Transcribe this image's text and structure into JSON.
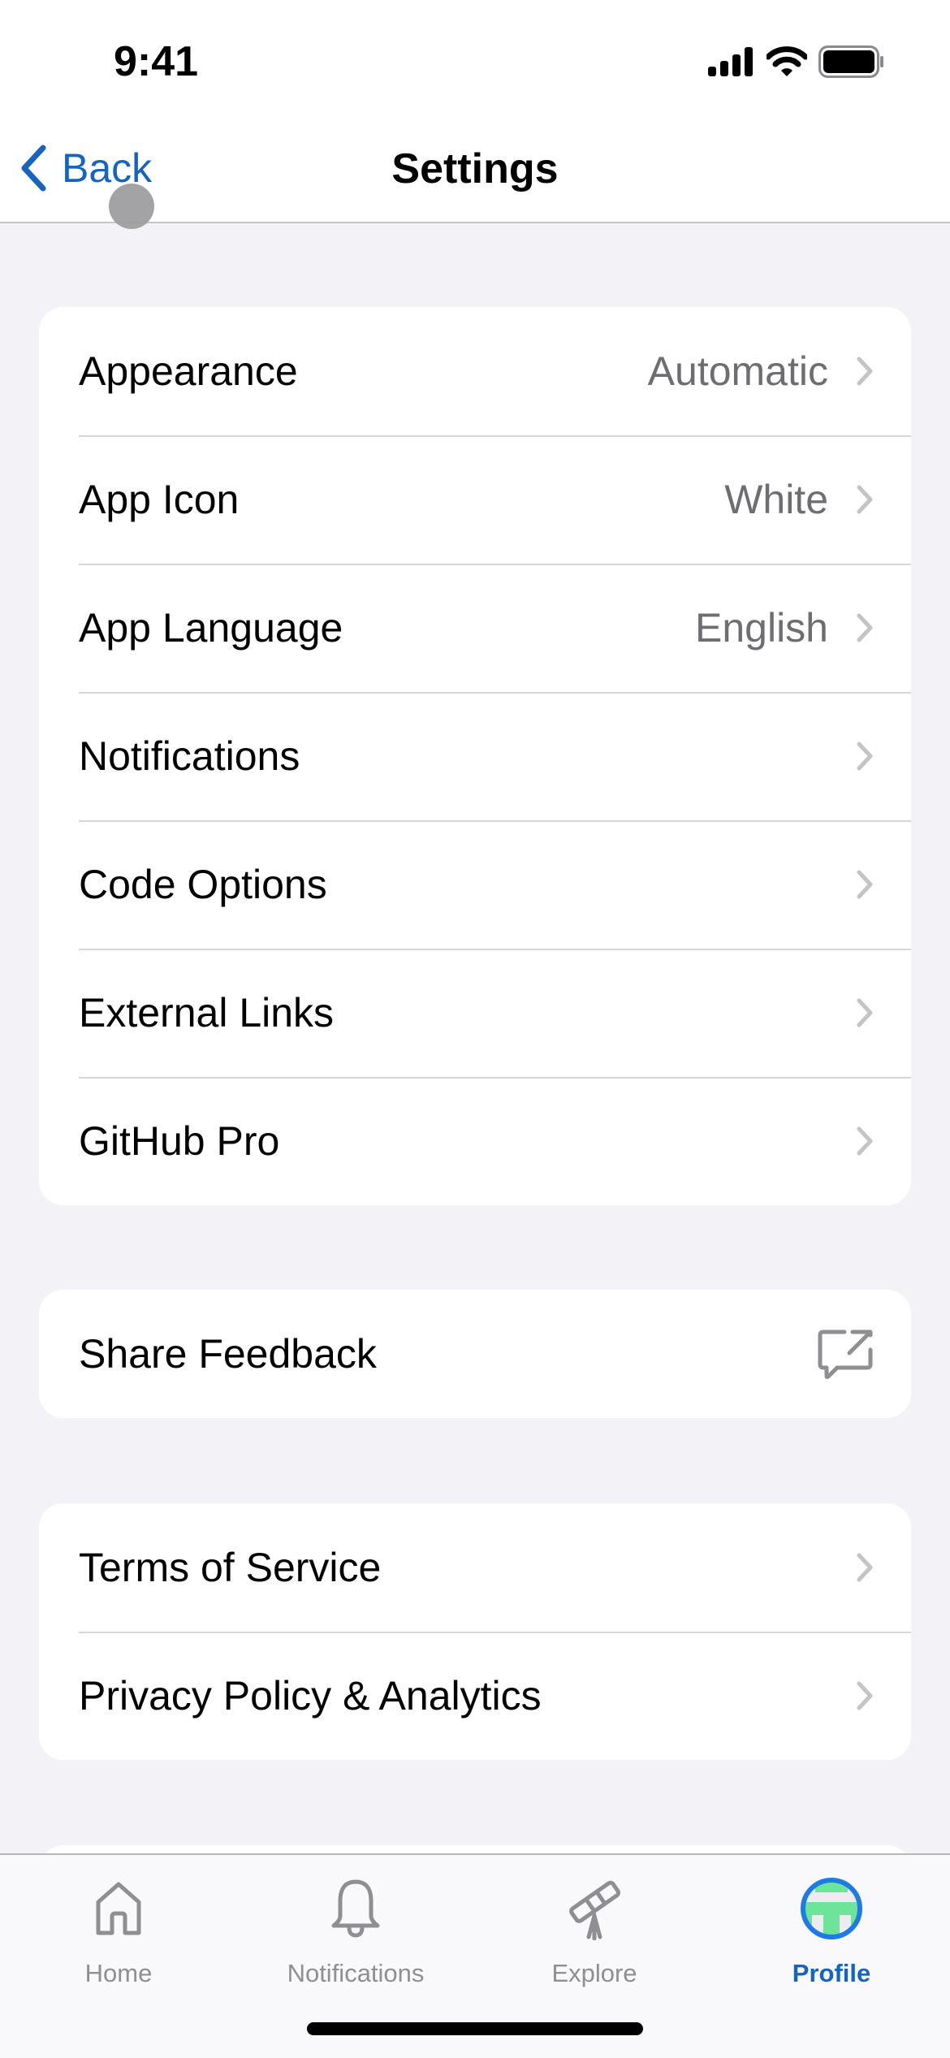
{
  "status_bar": {
    "time": "9:41",
    "icons": [
      "signal-icon",
      "wifi-icon",
      "battery-icon"
    ]
  },
  "nav": {
    "back_label": "Back",
    "title": "Settings"
  },
  "groups": [
    {
      "rows": [
        {
          "label": "Appearance",
          "value": "Automatic",
          "accessory": "chevron"
        },
        {
          "label": "App Icon",
          "value": "White",
          "accessory": "chevron"
        },
        {
          "label": "App Language",
          "value": "English",
          "accessory": "chevron"
        },
        {
          "label": "Notifications",
          "value": "",
          "accessory": "chevron"
        },
        {
          "label": "Code Options",
          "value": "",
          "accessory": "chevron"
        },
        {
          "label": "External Links",
          "value": "",
          "accessory": "chevron"
        },
        {
          "label": "GitHub Pro",
          "value": "",
          "accessory": "chevron"
        }
      ]
    },
    {
      "rows": [
        {
          "label": "Share Feedback",
          "value": "",
          "accessory": "external-feedback"
        }
      ]
    },
    {
      "rows": [
        {
          "label": "Terms of Service",
          "value": "",
          "accessory": "chevron"
        },
        {
          "label": "Privacy Policy & Analytics",
          "value": "",
          "accessory": "chevron"
        }
      ]
    }
  ],
  "tabbar": {
    "active": "Profile",
    "tabs": [
      {
        "label": "Home",
        "icon": "home-icon"
      },
      {
        "label": "Notifications",
        "icon": "bell-icon"
      },
      {
        "label": "Explore",
        "icon": "telescope-icon"
      },
      {
        "label": "Profile",
        "icon": "avatar"
      }
    ]
  },
  "colors": {
    "accent": "#1565c0",
    "background": "#f2f2f7",
    "secondary_text": "#6d6d72",
    "separator": "#d6d6d9",
    "avatar_green": "#6ee39a"
  }
}
